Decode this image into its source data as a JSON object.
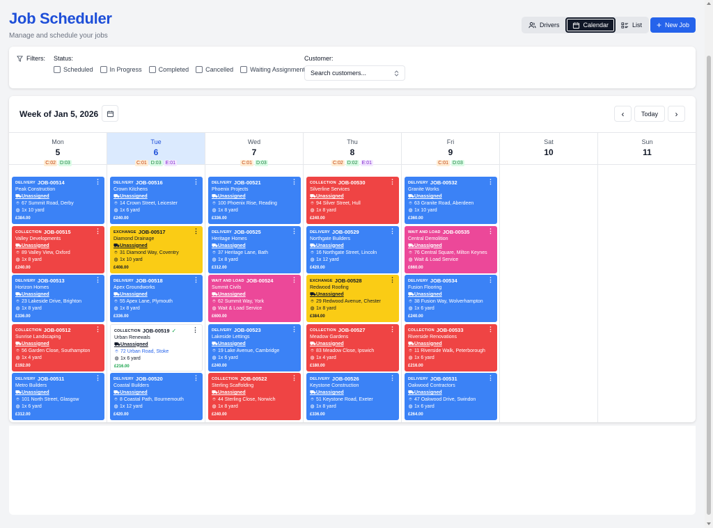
{
  "header": {
    "title": "Job Scheduler",
    "subtitle": "Manage and schedule your jobs"
  },
  "toolbar": {
    "views": [
      {
        "label": "Drivers",
        "icon": "users-icon",
        "active": false
      },
      {
        "label": "Calendar",
        "icon": "calendar-icon",
        "active": true
      },
      {
        "label": "List",
        "icon": "list-icon",
        "active": false
      }
    ],
    "new_job_label": "New Job"
  },
  "filters": {
    "label": "Filters:",
    "status_label": "Status:",
    "statuses": [
      "Scheduled",
      "In Progress",
      "Completed",
      "Cancelled",
      "Waiting Assignment"
    ],
    "customer_label": "Customer:",
    "customer_value": "Search customers..."
  },
  "calendar": {
    "week_title": "Week of Jan 5, 2026",
    "today_label": "Today",
    "prev_icon": "‹",
    "next_icon": "›",
    "days": [
      {
        "name": "Mon",
        "num": "5",
        "today": false,
        "badges": [
          {
            "t": "c",
            "label": "C:02"
          },
          {
            "t": "d",
            "label": "D:03"
          }
        ],
        "jobs": [
          {
            "kind": "delivery",
            "type": "DELIVERY",
            "id": "JOB-00514",
            "customer": "Peak Construction",
            "driver": "Unassigned",
            "address": "67 Summit Road, Derby",
            "size": "1x 10 yard",
            "price": "£384.00"
          },
          {
            "kind": "collection",
            "type": "COLLECTION",
            "id": "JOB-00515",
            "customer": "Valley Developments",
            "driver": "Unassigned",
            "address": "89 Valley View, Oxford",
            "size": "1x 8 yard",
            "price": "£240.00"
          },
          {
            "kind": "delivery",
            "type": "DELIVERY",
            "id": "JOB-00513",
            "customer": "Horizon Homes",
            "driver": "Unassigned",
            "address": "23 Lakeside Drive, Brighton",
            "size": "1x 8 yard",
            "price": "£336.00"
          },
          {
            "kind": "collection",
            "type": "COLLECTION",
            "id": "JOB-00512",
            "customer": "Sunrise Landscaping",
            "driver": "Unassigned",
            "address": "56 Garden Close, Southampton",
            "size": "1x 4 yard",
            "price": "£192.00"
          },
          {
            "kind": "delivery",
            "type": "DELIVERY",
            "id": "JOB-00511",
            "customer": "Metro Builders",
            "driver": "Unassigned",
            "address": "101 North Street, Glasgow",
            "size": "1x 6 yard",
            "price": "£312.00"
          }
        ]
      },
      {
        "name": "Tue",
        "num": "6",
        "today": true,
        "badges": [
          {
            "t": "c",
            "label": "C:01"
          },
          {
            "t": "d",
            "label": "D:03"
          },
          {
            "t": "e",
            "label": "E:01"
          }
        ],
        "jobs": [
          {
            "kind": "delivery",
            "type": "DELIVERY",
            "id": "JOB-00516",
            "customer": "Crown Kitchens",
            "driver": "Unassigned",
            "address": "14 Crown Street, Leicester",
            "size": "1x 6 yard",
            "price": "£240.00"
          },
          {
            "kind": "exchange",
            "type": "EXCHANGE",
            "id": "JOB-00517",
            "customer": "Diamond Drainage",
            "driver": "Unassigned",
            "address": "31 Diamond Way, Coventry",
            "size": "1x 10 yard",
            "price": "£408.00"
          },
          {
            "kind": "delivery",
            "type": "DELIVERY",
            "id": "JOB-00518",
            "customer": "Apex Groundworks",
            "driver": "Unassigned",
            "address": "55 Apex Lane, Plymouth",
            "size": "1x 8 yard",
            "price": "£336.00"
          },
          {
            "kind": "done",
            "type": "COLLECTION",
            "id": "JOB-00519",
            "customer": "Urban Renewals",
            "driver": "Unassigned",
            "address": "72 Urban Road, Stoke",
            "size": "1x 6 yard",
            "price": "£216.00",
            "completed": true
          },
          {
            "kind": "delivery",
            "type": "DELIVERY",
            "id": "JOB-00520",
            "customer": "Coastal Builders",
            "driver": "Unassigned",
            "address": "8 Coastal Path, Bournemouth",
            "size": "1x 12 yard",
            "price": "£420.00"
          }
        ]
      },
      {
        "name": "Wed",
        "num": "7",
        "today": false,
        "badges": [
          {
            "t": "c",
            "label": "C:01"
          },
          {
            "t": "d",
            "label": "D:03"
          }
        ],
        "jobs": [
          {
            "kind": "delivery",
            "type": "DELIVERY",
            "id": "JOB-00521",
            "customer": "Phoenix Projects",
            "driver": "Unassigned",
            "address": "100 Phoenix Rise, Reading",
            "size": "1x 8 yard",
            "price": "£336.00"
          },
          {
            "kind": "delivery",
            "type": "DELIVERY",
            "id": "JOB-00525",
            "customer": "Heritage Homes",
            "driver": "Unassigned",
            "address": "37 Heritage Lane, Bath",
            "size": "1x 8 yard",
            "price": "£312.00"
          },
          {
            "kind": "waitload",
            "type": "WAIT AND LOAD",
            "id": "JOB-00524",
            "customer": "Summit Civils",
            "driver": "Unassigned",
            "address": "62 Summit Way, York",
            "size": "Wait & Load Service",
            "price": "£600.00"
          },
          {
            "kind": "delivery",
            "type": "DELIVERY",
            "id": "JOB-00523",
            "customer": "Lakeside Lettings",
            "driver": "Unassigned",
            "address": "19 Lake Avenue, Cambridge",
            "size": "1x 6 yard",
            "price": "£240.00"
          },
          {
            "kind": "collection",
            "type": "COLLECTION",
            "id": "JOB-00522",
            "customer": "Sterling Scaffolding",
            "driver": "Unassigned",
            "address": "44 Sterling Close, Norwich",
            "size": "1x 8 yard",
            "price": "£240.00"
          }
        ]
      },
      {
        "name": "Thu",
        "num": "8",
        "today": false,
        "badges": [
          {
            "t": "c",
            "label": "C:02"
          },
          {
            "t": "d",
            "label": "D:02"
          },
          {
            "t": "e",
            "label": "E:01"
          }
        ],
        "jobs": [
          {
            "kind": "collection",
            "type": "COLLECTION",
            "id": "JOB-00530",
            "customer": "Silverline Services",
            "driver": "Unassigned",
            "address": "94 Silver Street, Hull",
            "size": "1x 8 yard",
            "price": "£240.00"
          },
          {
            "kind": "delivery",
            "type": "DELIVERY",
            "id": "JOB-00529",
            "customer": "Northgate Builders",
            "driver": "Unassigned",
            "address": "16 Northgate Street, Lincoln",
            "size": "1x 12 yard",
            "price": "£420.00"
          },
          {
            "kind": "exchange",
            "type": "EXCHANGE",
            "id": "JOB-00528",
            "customer": "Redwood Roofing",
            "driver": "Unassigned",
            "address": "29 Redwood Avenue, Chester",
            "size": "1x 8 yard",
            "price": "£384.00"
          },
          {
            "kind": "collection",
            "type": "COLLECTION",
            "id": "JOB-00527",
            "customer": "Meadow Gardens",
            "driver": "Unassigned",
            "address": "83 Meadow Close, Ipswich",
            "size": "1x 4 yard",
            "price": "£180.00"
          },
          {
            "kind": "delivery",
            "type": "DELIVERY",
            "id": "JOB-00526",
            "customer": "Keystone Construction",
            "driver": "Unassigned",
            "address": "51 Keystone Road, Exeter",
            "size": "1x 8 yard",
            "price": "£336.00"
          }
        ]
      },
      {
        "name": "Fri",
        "num": "9",
        "today": false,
        "badges": [
          {
            "t": "c",
            "label": "C:01"
          },
          {
            "t": "d",
            "label": "D:03"
          }
        ],
        "jobs": [
          {
            "kind": "delivery",
            "type": "DELIVERY",
            "id": "JOB-00532",
            "customer": "Granite Works",
            "driver": "Unassigned",
            "address": "63 Granite Road, Aberdeen",
            "size": "1x 10 yard",
            "price": "£360.00"
          },
          {
            "kind": "waitload",
            "type": "WAIT AND LOAD",
            "id": "JOB-00535",
            "customer": "Central Demolition",
            "driver": "Unassigned",
            "address": "76 Central Square, Milton Keynes",
            "size": "Wait & Load Service",
            "price": "£660.00"
          },
          {
            "kind": "delivery",
            "type": "DELIVERY",
            "id": "JOB-00534",
            "customer": "Fusion Flooring",
            "driver": "Unassigned",
            "address": "38 Fusion Way, Wolverhampton",
            "size": "1x 6 yard",
            "price": "£240.00"
          },
          {
            "kind": "collection",
            "type": "COLLECTION",
            "id": "JOB-00533",
            "customer": "Riverside Renovations",
            "driver": "Unassigned",
            "address": "11 Riverside Walk, Peterborough",
            "size": "1x 6 yard",
            "price": "£216.00"
          },
          {
            "kind": "delivery",
            "type": "DELIVERY",
            "id": "JOB-00531",
            "customer": "Oakwood Contractors",
            "driver": "Unassigned",
            "address": "47 Oakwood Drive, Swindon",
            "size": "1x 6 yard",
            "price": "£264.00"
          }
        ]
      },
      {
        "name": "Sat",
        "num": "10",
        "today": false,
        "badges": [],
        "jobs": []
      },
      {
        "name": "Sun",
        "num": "11",
        "today": false,
        "badges": [],
        "jobs": []
      }
    ]
  },
  "colors": {
    "accent": "#2563eb",
    "title": "#1d4ed8",
    "delivery": "#3b82f6",
    "collection": "#ef4444",
    "exchange": "#facc15",
    "wait_load": "#ec4899",
    "today_bg": "#dbeafe"
  }
}
